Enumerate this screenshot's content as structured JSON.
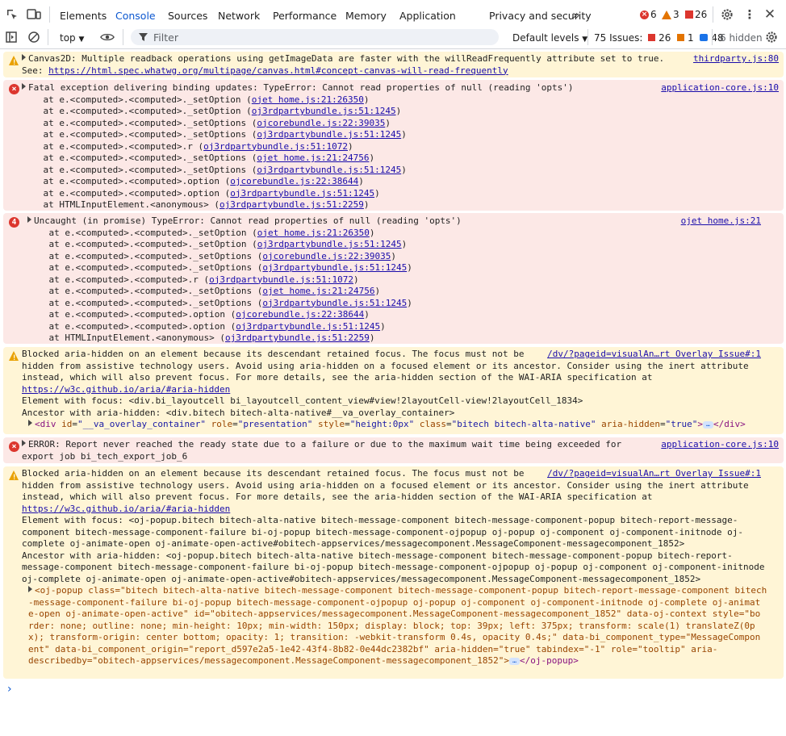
{
  "tabs": [
    "Elements",
    "Console",
    "Sources",
    "Network",
    "Performance",
    "Memory",
    "Application",
    "Privacy and security"
  ],
  "active_tab": "Console",
  "counts": {
    "errors": "6",
    "warnings": "3",
    "issues": "26"
  },
  "toolbar": {
    "context": "top",
    "filter_placeholder": "Filter",
    "levels": "Default levels",
    "issues_label": "75 Issues:",
    "issues_err": "26",
    "issues_warn": "1",
    "issues_info": "48",
    "hidden": "6 hidden"
  },
  "messages": {
    "m1": {
      "l1": "Canvas2D: Multiple readback operations using getImageData are faster with the willReadFrequently attribute set to true.",
      "l2_prefix": "See: ",
      "l2_link": "https://html.spec.whatwg.org/multipage/canvas.html#concept-canvas-will-read-frequently",
      "src": "thirdparty.js:80"
    },
    "m2": {
      "l1": "Fatal exception delivering binding updates: TypeError: Cannot read properties of null (reading 'opts')",
      "src": "application-core.js:10",
      "stack": [
        [
          "    at e.<computed>.<computed>._setOption (",
          "ojet home.js:21:26350",
          ")"
        ],
        [
          "    at e.<computed>.<computed>._setOption (",
          "oj3rdpartybundle.js:51:1245",
          ")"
        ],
        [
          "    at e.<computed>.<computed>._setOptions (",
          "ojcorebundle.js:22:39035",
          ")"
        ],
        [
          "    at e.<computed>.<computed>._setOptions (",
          "oj3rdpartybundle.js:51:1245",
          ")"
        ],
        [
          "    at e.<computed>.<computed>.r (",
          "oj3rdpartybundle.js:51:1072",
          ")"
        ],
        [
          "    at e.<computed>.<computed>._setOptions (",
          "ojet home.js:21:24756",
          ")"
        ],
        [
          "    at e.<computed>.<computed>._setOptions (",
          "oj3rdpartybundle.js:51:1245",
          ")"
        ],
        [
          "    at e.<computed>.<computed>.option (",
          "ojcorebundle.js:22:38644",
          ")"
        ],
        [
          "    at e.<computed>.<computed>.option (",
          "oj3rdpartybundle.js:51:1245",
          ")"
        ],
        [
          "    at HTMLInputElement.<anonymous> (",
          "oj3rdpartybundle.js:51:2259",
          ")"
        ]
      ]
    },
    "m3": {
      "count": "4",
      "l1": "Uncaught (in promise) TypeError: Cannot read properties of null (reading 'opts')",
      "src": "ojet home.js:21",
      "stack": [
        [
          "    at e.<computed>.<computed>._setOption (",
          "ojet home.js:21:26350",
          ")"
        ],
        [
          "    at e.<computed>.<computed>._setOption (",
          "oj3rdpartybundle.js:51:1245",
          ")"
        ],
        [
          "    at e.<computed>.<computed>._setOptions (",
          "ojcorebundle.js:22:39035",
          ")"
        ],
        [
          "    at e.<computed>.<computed>._setOptions (",
          "oj3rdpartybundle.js:51:1245",
          ")"
        ],
        [
          "    at e.<computed>.<computed>.r (",
          "oj3rdpartybundle.js:51:1072",
          ")"
        ],
        [
          "    at e.<computed>.<computed>._setOptions (",
          "ojet home.js:21:24756",
          ")"
        ],
        [
          "    at e.<computed>.<computed>._setOptions (",
          "oj3rdpartybundle.js:51:1245",
          ")"
        ],
        [
          "    at e.<computed>.<computed>.option (",
          "ojcorebundle.js:22:38644",
          ")"
        ],
        [
          "    at e.<computed>.<computed>.option (",
          "oj3rdpartybundle.js:51:1245",
          ")"
        ],
        [
          "    at HTMLInputElement.<anonymous> (",
          "oj3rdpartybundle.js:51:2259",
          ")"
        ]
      ]
    },
    "m4": {
      "src": "/dv/?pageid=visualAn…rt Overlay Issue#:1",
      "lines": [
        "Blocked aria-hidden on an element because its descendant retained focus. The focus must not be",
        "hidden from assistive technology users. Avoid using aria-hidden on a focused element or its ancestor. Consider using the inert attribute",
        "instead, which will also prevent focus. For more details, see the aria-hidden section of the WAI-ARIA specification at"
      ],
      "link": "https://w3c.github.io/aria/#aria-hidden",
      "focus": "Element with focus: <div.bi_layoutcell bi_layoutcell_content_view#view!2layoutCell-view!2layoutCell_1834>",
      "ancestor": "Ancestor with aria-hidden: <div.bitech bitech-alta-native#__va_overlay_container>",
      "node_tag_open": "<div",
      "node_attrs": [
        [
          "id",
          "\"__va_overlay_container\""
        ],
        [
          "role",
          "\"presentation\""
        ],
        [
          "style",
          "\"height:0px\""
        ],
        [
          "class",
          "\"bitech bitech-alta-native\""
        ],
        [
          "aria-hidden",
          "\"true\""
        ]
      ],
      "node_close": "</div>"
    },
    "m5": {
      "l1": "ERROR: Report never reached the ready state due to a failure or due to the maximum wait time being exceeded for",
      "l2": "export job bi_tech_export_job_6",
      "src": "application-core.js:10"
    },
    "m6": {
      "src": "/dv/?pageid=visualAn…rt Overlay Issue#:1",
      "lines": [
        "Blocked aria-hidden on an element because its descendant retained focus. The focus must not be",
        "hidden from assistive technology users. Avoid using aria-hidden on a focused element or its ancestor. Consider using the inert attribute",
        "instead, which will also prevent focus. For more details, see the aria-hidden section of the WAI-ARIA specification at"
      ],
      "link": "https://w3c.github.io/aria/#aria-hidden",
      "focus_lines": [
        "Element with focus: <oj-popup.bitech bitech-alta-native bitech-message-component bitech-message-component-popup bitech-report-message-",
        "component bitech-message-component-failure bi-oj-popup bitech-message-component-ojpopup oj-popup oj-component oj-component-initnode oj-",
        "complete oj-animate-open oj-animate-open-active#obitech-appservices/messagecomponent.MessageComponent-messagecomponent_1852>"
      ],
      "ancestor_lines": [
        "Ancestor with aria-hidden: <oj-popup.bitech bitech-alta-native bitech-message-component bitech-message-component-popup bitech-report-",
        "message-component bitech-message-component-failure bi-oj-popup bitech-message-component-ojpopup oj-popup oj-component oj-component-initnode",
        "oj-complete oj-animate-open oj-animate-open-active#obitech-appservices/messagecomponent.MessageComponent-messagecomponent_1852>"
      ],
      "node_lines": [
        "<oj-popup class=\"bitech bitech-alta-native bitech-message-component bitech-message-component-popup bitech-report-message-component bitech",
        "-message-component-failure bi-oj-popup bitech-message-component-ojpopup oj-popup oj-component oj-component-initnode oj-complete oj-animat",
        "e-open oj-animate-open-active\" id=\"obitech-appservices/messagecomponent.MessageComponent-messagecomponent_1852\" data-oj-context style=\"bo",
        "rder: none; outline: none; min-height: 10px; min-width: 150px; display: block; top: 39px; left: 375px; transform: scale(1) translateZ(0p",
        "x); transform-origin: center bottom; opacity: 1; transition: -webkit-transform 0.4s, opacity 0.4s;\" data-bi_component_type=\"MessageCompon",
        "ent\" data-bi_component_origin=\"report_d597e2a5-1e42-43f4-8b82-0e44dc2382bf\" aria-hidden=\"true\" tabindex=\"-1\" role=\"tooltip\" aria-",
        "describedby=\"obitech-appservices/messagecomponent.MessageComponent-messagecomponent_1852\">"
      ],
      "node_close": "</oj-popup>"
    }
  },
  "prompt": "›"
}
